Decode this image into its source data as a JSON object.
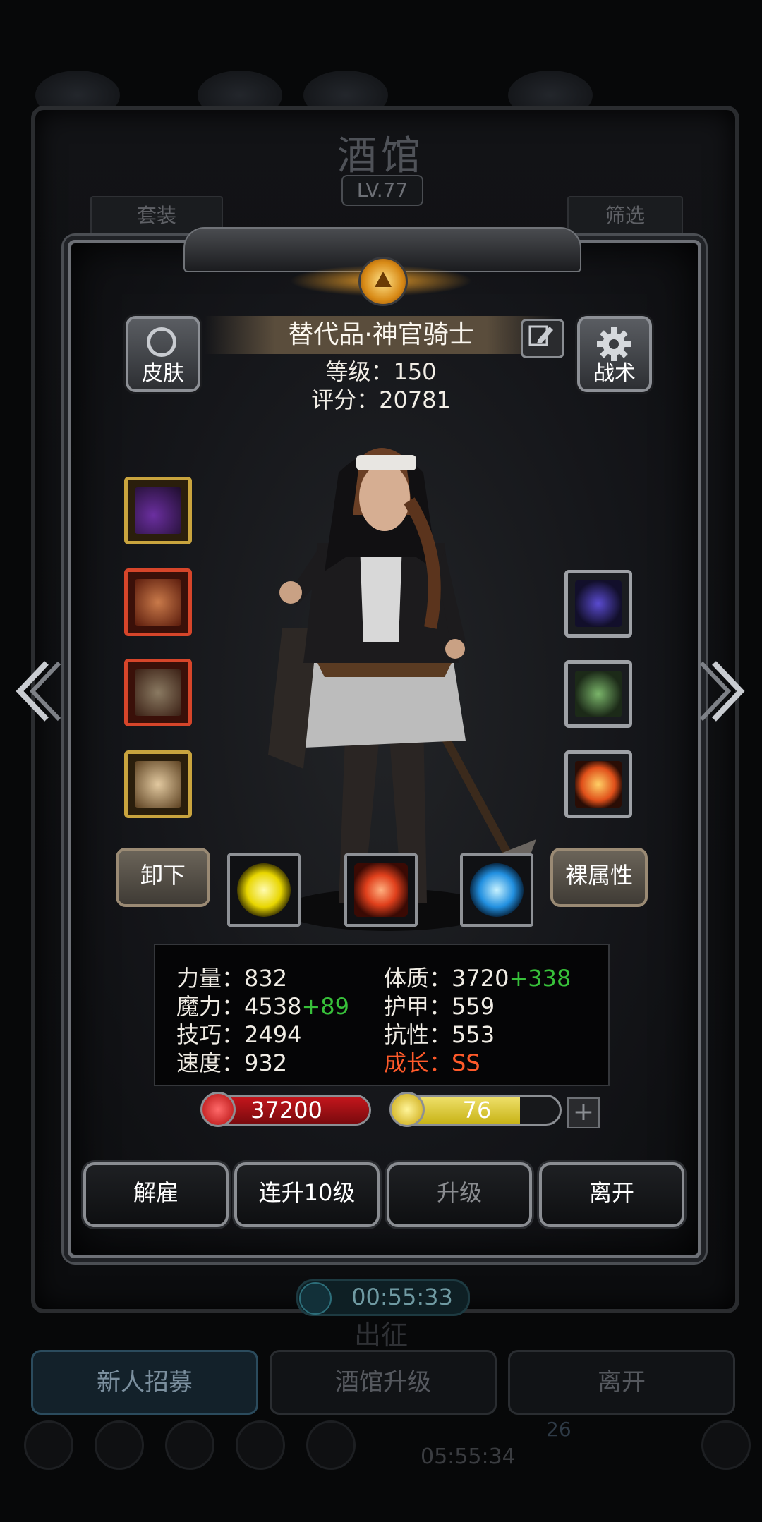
{
  "background": {
    "title": "酒馆",
    "level": "LV.77",
    "tab_left": "套装",
    "tab_right": "筛选",
    "timer": "00:55:33",
    "deploy_label": "出征",
    "buttons": [
      "新人招募",
      "酒馆升级",
      "离开"
    ],
    "bottom_timer": "05:55:34",
    "bottom_count": "26"
  },
  "hero": {
    "name": "替代品·神官骑士",
    "level_label": "等级：150",
    "score_label": "评分：20781"
  },
  "side_buttons": {
    "skin": "皮肤",
    "tactics": "战术"
  },
  "equipment_left": [
    "staff-icon",
    "armor-icon",
    "tome-icon",
    "scroll-icon"
  ],
  "equipment_right": [
    "dark-gem-icon",
    "leaf-icon",
    "fire-orb-icon"
  ],
  "row_buttons": {
    "unequip": "卸下",
    "bare_attributes": "裸属性"
  },
  "skills": [
    "fist-skill-icon",
    "heal-cross-skill-icon",
    "eye-skill-icon"
  ],
  "stats": {
    "strength": {
      "label": "力量：832"
    },
    "constitution": {
      "label": "体质：3720",
      "bonus": "+338"
    },
    "magic": {
      "label": "魔力：4538",
      "bonus": "+89"
    },
    "armor": {
      "label": "护甲：559"
    },
    "skill": {
      "label": "技巧：2494"
    },
    "resistance": {
      "label": "抗性：553"
    },
    "speed": {
      "label": "速度：932"
    },
    "growth": {
      "label": "成长：SS"
    }
  },
  "bars": {
    "hp": {
      "value": "37200",
      "fill": 1.0,
      "color": "#c4161c"
    },
    "energy": {
      "value": "76",
      "fill": 0.76,
      "color": "#c9b418"
    }
  },
  "plus_label": "+",
  "actions": {
    "dismiss": "解雇",
    "level_up_10": "连升10级",
    "level_up": "升级",
    "leave": "离开"
  }
}
